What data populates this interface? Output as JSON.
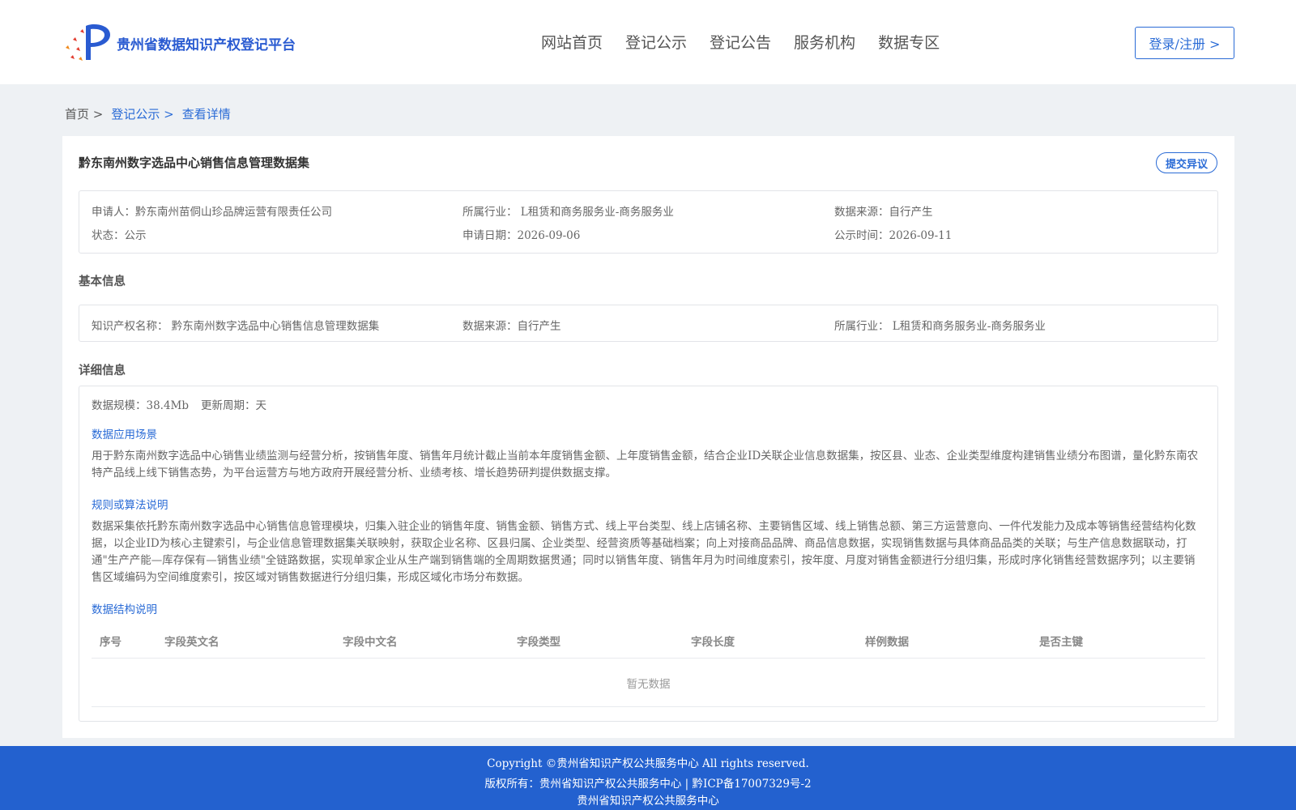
{
  "header": {
    "site_name": "贵州省数据知识产权登记平台",
    "nav": [
      "网站首页",
      "登记公示",
      "登记公告",
      "服务机构",
      "数据专区"
    ],
    "login_label": "登录/注册 >"
  },
  "breadcrumb": {
    "home": "首页 >",
    "section": "登记公示 >",
    "current": "查看详情"
  },
  "detail": {
    "title": "黔东南州数字选品中心销售信息管理数据集",
    "objection_label": "提交异议",
    "summary": {
      "applicant": "申请人：黔东南州苗侗山珍品牌运营有限责任公司",
      "industry": "所属行业： L租赁和商务服务业-商务服务业",
      "source": "数据来源：自行产生",
      "status": "状态：公示",
      "apply_date": "申请日期：2026-09-06",
      "publish_time": "公示时间：2026-09-11"
    },
    "basic_title": "基本信息",
    "basic": {
      "ip_name": "知识产权名称： 黔东南州数字选品中心销售信息管理数据集",
      "source": "数据来源：自行产生",
      "industry": "所属行业： L租赁和商务服务业-商务服务业"
    },
    "detail_title": "详细信息",
    "scale": "数据规模：38.4Mb",
    "cycle": "更新周期：天",
    "scenario_title": "数据应用场景",
    "scenario_text": "用于黔东南州数字选品中心销售业绩监测与经营分析，按销售年度、销售年月统计截止当前本年度销售金额、上年度销售金额，结合企业ID关联企业信息数据集，按区县、业态、企业类型维度构建销售业绩分布图谱，量化黔东南农特产品线上线下销售态势，为平台运营方与地方政府开展经营分析、业绩考核、增长趋势研判提供数据支撑。",
    "rule_title": "规则或算法说明",
    "rule_text": "数据采集依托黔东南州数字选品中心销售信息管理模块，归集入驻企业的销售年度、销售金额、销售方式、线上平台类型、线上店铺名称、主要销售区域、线上销售总额、第三方运营意向、一件代发能力及成本等销售经营结构化数据，以企业ID为核心主键索引，与企业信息管理数据集关联映射，获取企业名称、区县归属、企业类型、经营资质等基础档案；向上对接商品品牌、商品信息数据，实现销售数据与具体商品品类的关联；与生产信息数据联动，打通\"生产产能—库存保有—销售业绩\"全链路数据，实现单家企业从生产端到销售端的全周期数据贯通；同时以销售年度、销售年月为时间维度索引，按年度、月度对销售金额进行分组归集，形成时序化销售经营数据序列；以主要销售区域编码为空间维度索引，按区域对销售数据进行分组归集，形成区域化市场分布数据。",
    "structure_title": "数据结构说明",
    "table_headers": [
      "序号",
      "字段英文名",
      "字段中文名",
      "字段类型",
      "字段长度",
      "样例数据",
      "是否主键"
    ],
    "empty_text": "暂无数据"
  },
  "footer": {
    "line1": "Copyright ©贵州省知识产权公共服务中心 All rights reserved.",
    "line2": "版权所有：贵州省知识产权公共服务中心 | 黔ICP备17007329号-2",
    "line3": "贵州省知识产权公共服务中心"
  },
  "colors": {
    "brand": "#2a5bd1",
    "link": "#2a6bd6",
    "footer_bg": "#2361cf",
    "logo_red": "#e23b2e",
    "logo_orange": "#f08a1c"
  }
}
